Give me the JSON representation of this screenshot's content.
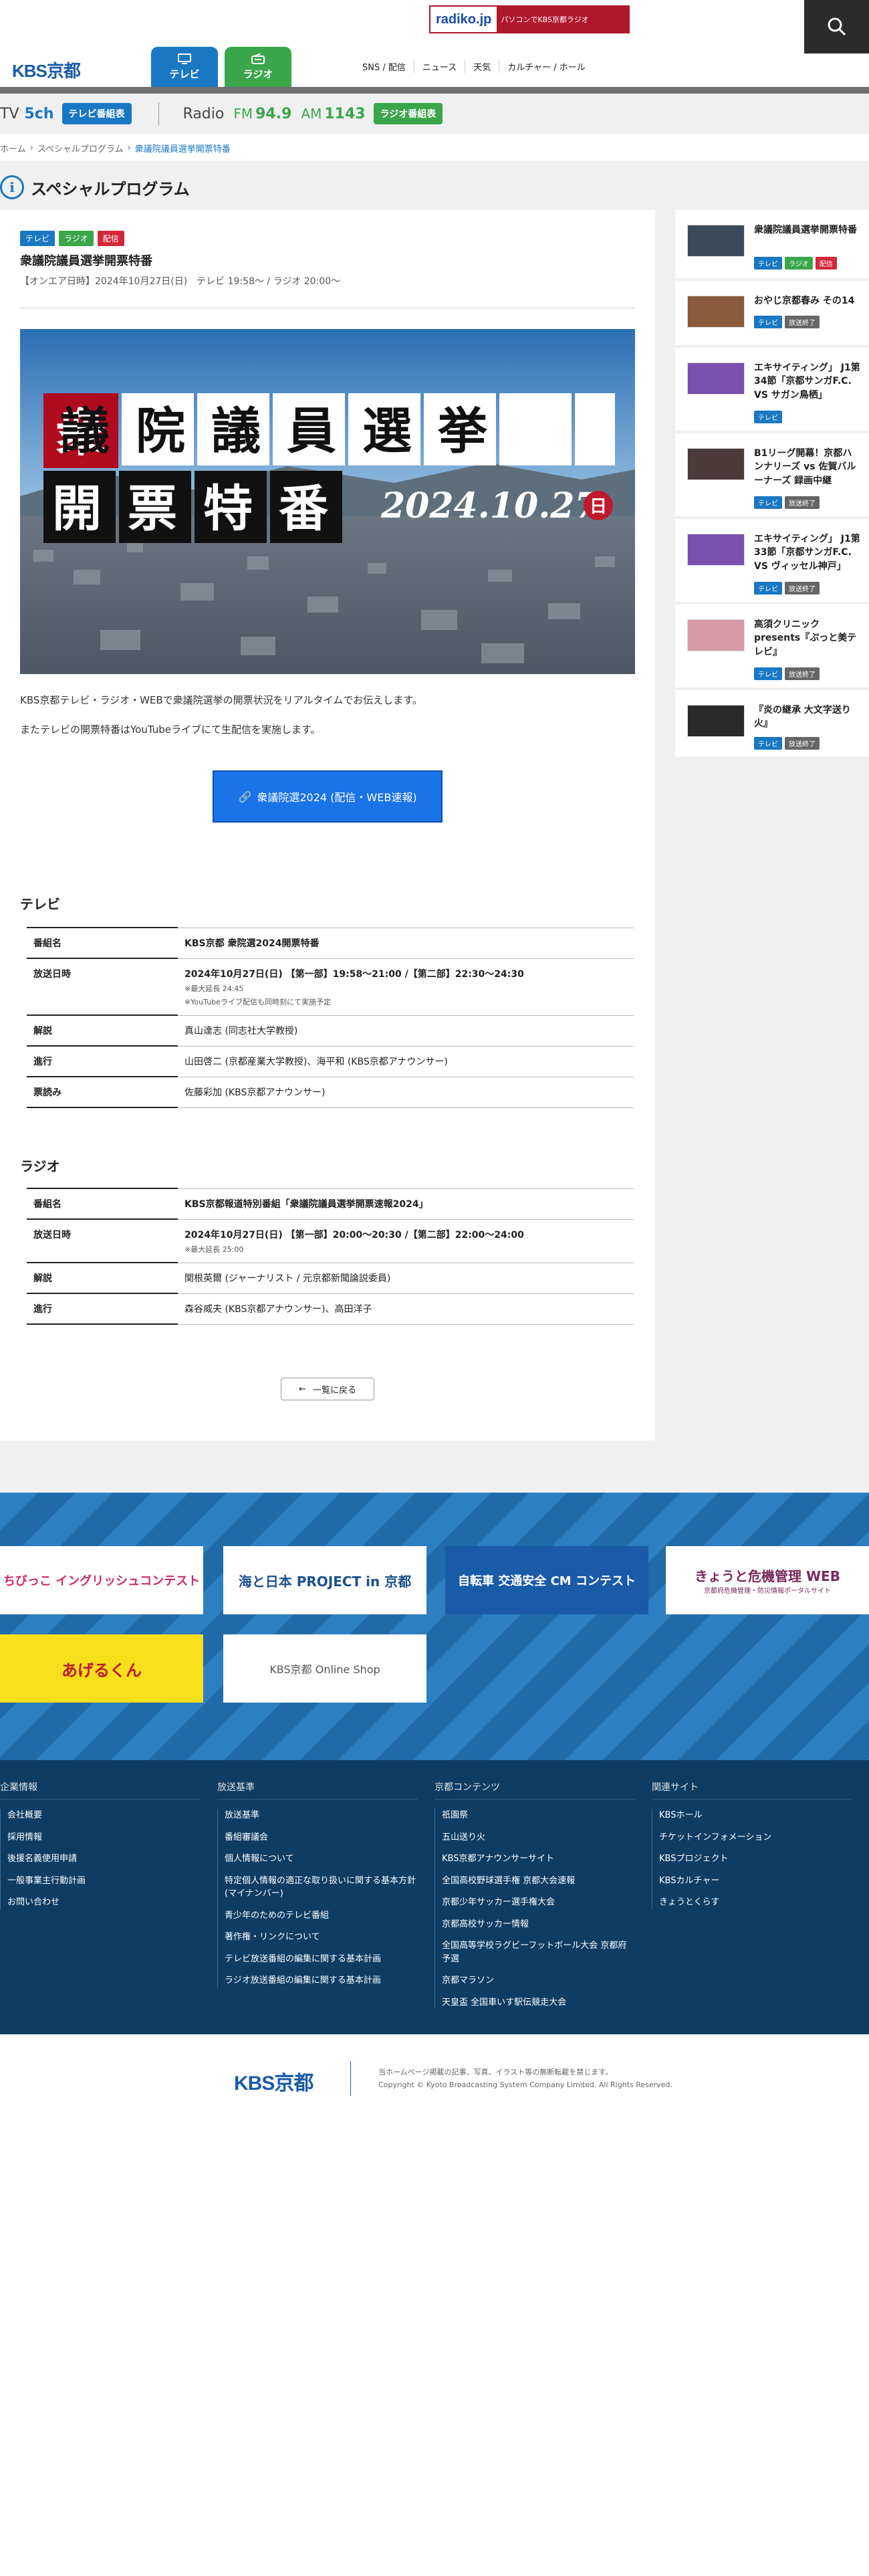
{
  "header": {
    "logo": "KBS京都",
    "radiko_logo": "radiko.jp",
    "radiko_text": "パソコンでKBS京都ラジオ",
    "tabs": [
      {
        "label": "テレビ"
      },
      {
        "label": "ラジオ"
      }
    ],
    "menu": [
      "SNS / 配信",
      "ニュース",
      "天気",
      "カルチャー / ホール"
    ]
  },
  "channel_bar": {
    "tv_label": "TV",
    "tv_ch": "5ch",
    "tv_badge": "テレビ番組表",
    "radio_label": "Radio",
    "fm_label": "FM",
    "fm_value": "94.9",
    "am_label": "AM",
    "am_value": "1143",
    "radio_badge": "ラジオ番組表"
  },
  "breadcrumb": [
    "ホーム",
    "スペシャルプログラム",
    "衆議院議員選挙開票特番"
  ],
  "page_title": "スペシャルプログラム",
  "program": {
    "tags": [
      "テレビ",
      "ラジオ",
      "配信"
    ],
    "title": "衆議院議員選挙開票特番",
    "onair": "【オンエア日時】2024年10月27日(日)　テレビ 19:58〜 / ラジオ 20:00〜",
    "hero_line1": "衆議院議員選挙",
    "hero_line2": "開票特番",
    "hero_date": "2024.10.27",
    "hero_day": "日",
    "desc1": "KBS京都テレビ・ラジオ・WEBで衆議院選挙の開票状況をリアルタイムでお伝えします。",
    "desc2": "またテレビの開票特番はYouTubeライブにて生配信を実施します。",
    "link_label": "衆議院選2024 (配信・WEB速報)"
  },
  "tv_section": {
    "heading": "テレビ",
    "rows": [
      {
        "k": "番組名",
        "v": "KBS京都 衆院選2024開票特番",
        "note": ""
      },
      {
        "k": "放送日時",
        "v": "2024年10月27日(日) 【第一部】19:58〜21:00 /【第二部】22:30〜24:30",
        "note": "※最大延長 24:45",
        "note2": "※YouTubeライブ配信も同時刻にて実施予定"
      },
      {
        "k": "解説",
        "v": "真山達志 (同志社大学教授)",
        "note": ""
      },
      {
        "k": "進行",
        "v": "山田啓二 (京都産業大学教授)、海平和 (KBS京都アナウンサー)",
        "note": ""
      },
      {
        "k": "票読み",
        "v": "佐藤彩加 (KBS京都アナウンサー)",
        "note": ""
      }
    ]
  },
  "radio_section": {
    "heading": "ラジオ",
    "rows": [
      {
        "k": "番組名",
        "v": "KBS京都報道特別番組「衆議院議員選挙開票速報2024」",
        "note": ""
      },
      {
        "k": "放送日時",
        "v": "2024年10月27日(日) 【第一部】20:00〜20:30 /【第二部】22:00〜24:00",
        "note": "※最大延長 25:00"
      },
      {
        "k": "解説",
        "v": "関根英爾 (ジャーナリスト / 元京都新聞論説委員)",
        "note": ""
      },
      {
        "k": "進行",
        "v": "森谷威夫 (KBS京都アナウンサー)、高田洋子",
        "note": ""
      }
    ]
  },
  "back_label": "一覧に戻る",
  "sidebar": [
    {
      "title": "衆議院議員選挙開票特番",
      "tags": [
        "テレビ",
        "ラジオ",
        "配信"
      ],
      "thumb": "#3a4a5c"
    },
    {
      "title": "おやじ京都春み その14",
      "tags": [
        "テレビ",
        "放送終了"
      ],
      "thumb": "#8b5a3a"
    },
    {
      "title": "エキサイティング」 J1第34節「京都サンガF.C. VS サガン鳥栖」",
      "tags": [
        "テレビ"
      ],
      "thumb": "#7a4fb0"
    },
    {
      "title": "B1リーグ開幕！京都ハンナリーズ vs 佐賀バルーナーズ 録画中継",
      "tags": [
        "テレビ",
        "放送終了"
      ],
      "thumb": "#4a3a3a"
    },
    {
      "title": "エキサイティング」 J1第33節「京都サンガF.C. VS ヴィッセル神戸」",
      "tags": [
        "テレビ",
        "放送終了"
      ],
      "thumb": "#7a4fb0"
    },
    {
      "title": "高須クリニック presents『ぷっと美テレビ』",
      "tags": [
        "テレビ",
        "放送終了"
      ],
      "thumb": "#d89aa8"
    },
    {
      "title": "『炎の継承 大文字送り火』",
      "tags": [
        "テレビ",
        "放送終了"
      ],
      "thumb": "#2a2a2a"
    }
  ],
  "banners": {
    "b1": "ちびっこ イングリッシュコンテスト",
    "b2": "海と日本 PROJECT in 京都",
    "b3": "自転車 交通安全 CM コンテスト",
    "b4": "きょうと危機管理 WEB",
    "b4sub": "京都府危機管理・防災情報ポータルサイト",
    "b5": "あげるくん",
    "b6": "KBS京都 Online Shop"
  },
  "footer": {
    "cols": [
      {
        "title": "企業情報",
        "items": [
          "会社概要",
          "採用情報",
          "後援名義使用申請",
          "一般事業主行動計画",
          "お問い合わせ"
        ]
      },
      {
        "title": "放送基準",
        "items": [
          "放送基準",
          "番組審議会",
          "個人情報について",
          "特定個人情報の適正な取り扱いに関する基本方針(マイナンバー)",
          "青少年のためのテレビ番組",
          "著作権・リンクについて",
          "テレビ放送番組の編集に関する基本計画",
          "ラジオ放送番組の編集に関する基本計画"
        ]
      },
      {
        "title": "京都コンテンツ",
        "items": [
          "祇園祭",
          "五山送り火",
          "KBS京都アナウンサーサイト",
          "全国高校野球選手権 京都大会速報",
          "京都少年サッカー選手権大会",
          "京都高校サッカー情報",
          "全国高等学校ラグビーフットボール大会 京都府予選",
          "京都マラソン",
          "天皇盃 全国車いす駅伝競走大会"
        ]
      },
      {
        "title": "関連サイト",
        "items": [
          "KBSホール",
          "チケットインフォメーション",
          "KBSプロジェクト",
          "KBSカルチャー",
          "きょうとくらす"
        ]
      }
    ],
    "logo": "KBS京都",
    "copy1": "当ホームページ掲載の記事、写真、イラスト等の無断転載を禁じます。",
    "copy2": "Copyright © Kyoto Broadcasting System Company Limited. All Rights Reserved."
  }
}
